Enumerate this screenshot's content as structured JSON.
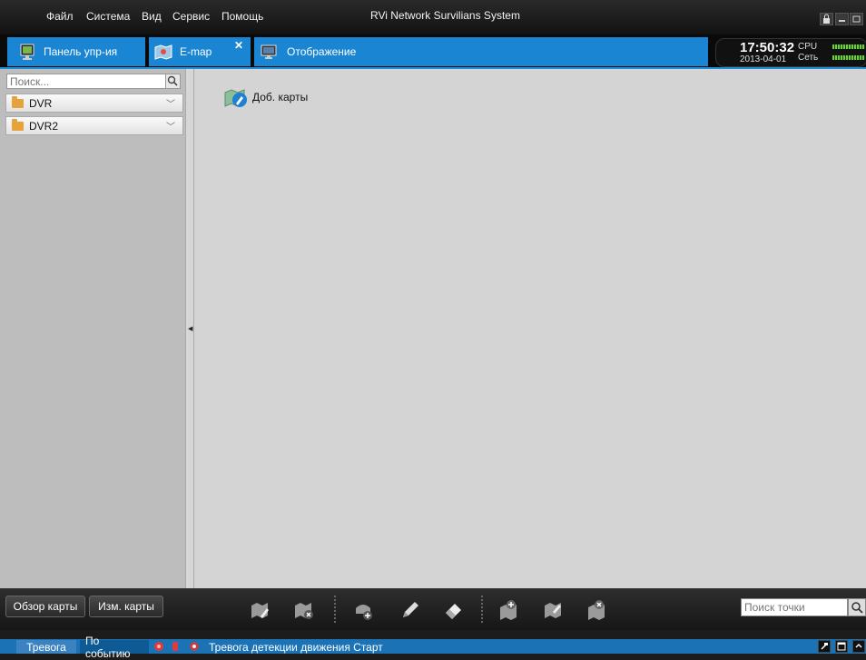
{
  "menu": {
    "items": [
      "Файл",
      "Система",
      "Вид",
      "Сервис",
      "Помощь"
    ],
    "app_title": "RVi Network Survilians System"
  },
  "tabs": [
    {
      "label": "Панель упр-ия",
      "icon": "control-panel-icon"
    },
    {
      "label": "E-map",
      "icon": "emap-icon",
      "active": true,
      "closable": true
    },
    {
      "label": "Отображение",
      "icon": "display-monitor-icon"
    }
  ],
  "clock": {
    "time": "17:50:32",
    "date": "2013-04-01",
    "cpu_label": "CPU",
    "net_label": "Сеть"
  },
  "sidebar": {
    "search_placeholder": "Поиск...",
    "items": [
      {
        "label": "DVR",
        "icon": "folder-icon"
      },
      {
        "label": "DVR2",
        "icon": "folder-icon"
      }
    ]
  },
  "main": {
    "add_map_label": "Доб. карты",
    "add_map_icon": "add-map-icon"
  },
  "toolbar": {
    "overview_label": "Обзор карты",
    "edit_label": "Изм. карты",
    "point_search_placeholder": "Поиск точки",
    "icons": [
      "edit-map-icon",
      "delete-map-icon",
      "add-camera-icon",
      "pencil-icon",
      "eraser-icon",
      "add-hotspot-icon",
      "edit-hotspot-icon",
      "delete-hotspot-icon"
    ]
  },
  "statusbar": {
    "tab_alarm": "Тревога",
    "tab_event": "По событию",
    "message": "Тревога детекции движения Старт"
  },
  "colors": {
    "accent": "#1a85d3",
    "panel_bg": "#bdbdbd",
    "main_bg": "#d4d4d4",
    "status_bar": "#1b73b6"
  }
}
